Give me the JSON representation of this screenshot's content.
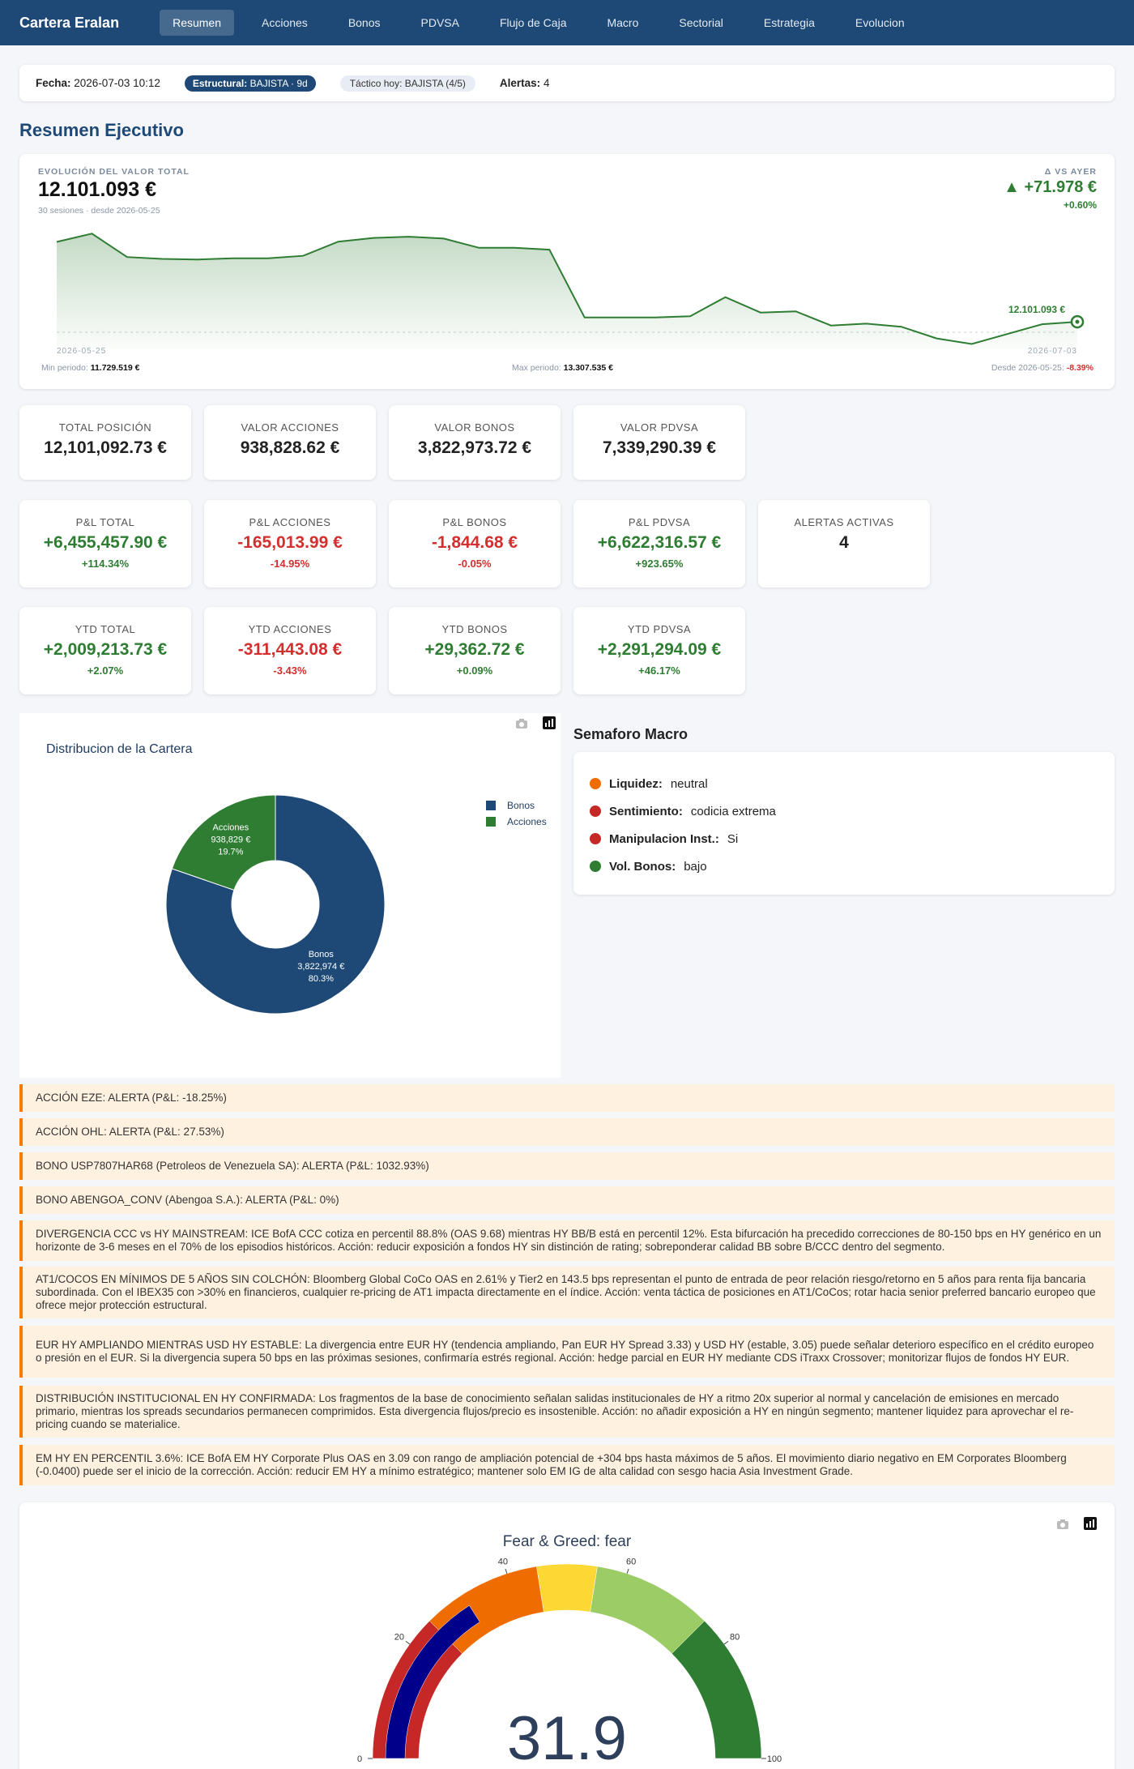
{
  "nav": {
    "brand": "Cartera Eralan",
    "tabs": [
      "Resumen",
      "Acciones",
      "Bonos",
      "PDVSA",
      "Flujo de Caja",
      "Macro",
      "Sectorial",
      "Estrategia",
      "Evolucion"
    ]
  },
  "infobar": {
    "fecha_label": "Fecha:",
    "fecha_value": "2026-07-03 10:12",
    "estructural_label": "Estructural:",
    "estructural_value": "BAJISTA · 9d",
    "tactico": "Táctico hoy: BAJISTA (4/5)",
    "alertas_label": "Alertas:",
    "alertas_value": "4"
  },
  "section_title": "Resumen Ejecutivo",
  "evolution": {
    "label": "EVOLUCIÓN DEL VALOR TOTAL",
    "value": "12.101.093 €",
    "sub": "30 sesiones · desde 2026-05-25",
    "delta_label": "Δ VS AYER",
    "delta_value": "▲ +71.978 €",
    "delta_pct": "+0.60%",
    "end_label": "12.101.093 €",
    "start_date": "2026-05-25",
    "end_date": "2026-07-03",
    "min_label": "Min periodo:",
    "min_value": "11.729.519 €",
    "max_label": "Max periodo:",
    "max_value": "13.307.535 €",
    "since_label": "Desde 2026-05-25:",
    "since_value": "-8.39%",
    "series": [
      13108000,
      13175000,
      12985000,
      12970000,
      12965000,
      12975000,
      12975000,
      12995000,
      13110000,
      13140000,
      13150000,
      13135000,
      13060000,
      13060000,
      13045000,
      12495000,
      12495000,
      12495000,
      12505000,
      12660000,
      12535000,
      12545000,
      12430000,
      12445000,
      12420000,
      12325000,
      12280000,
      12360000,
      12440000,
      12460000
    ]
  },
  "stats_row1": [
    {
      "label": "TOTAL POSICIÓN",
      "value": "12,101,092.73 €"
    },
    {
      "label": "VALOR ACCIONES",
      "value": "938,828.62 €"
    },
    {
      "label": "VALOR BONOS",
      "value": "3,822,973.72 €"
    },
    {
      "label": "VALOR PDVSA",
      "value": "7,339,290.39 €"
    }
  ],
  "stats_row2": [
    {
      "label": "P&L TOTAL",
      "value": "+6,455,457.90 €",
      "pct": "+114.34%"
    },
    {
      "label": "P&L ACCIONES",
      "value": "-165,013.99 €",
      "pct": "-14.95%"
    },
    {
      "label": "P&L BONOS",
      "value": "-1,844.68 €",
      "pct": "-0.05%"
    },
    {
      "label": "P&L PDVSA",
      "value": "+6,622,316.57 €",
      "pct": "+923.65%"
    },
    {
      "label": "ALERTAS ACTIVAS",
      "value": "4"
    }
  ],
  "stats_row3": [
    {
      "label": "YTD TOTAL",
      "value": "+2,009,213.73 €",
      "pct": "+2.07%"
    },
    {
      "label": "YTD ACCIONES",
      "value": "-311,443.08 €",
      "pct": "-3.43%"
    },
    {
      "label": "YTD BONOS",
      "value": "+29,362.72 €",
      "pct": "+0.09%"
    },
    {
      "label": "YTD PDVSA",
      "value": "+2,291,294.09 €",
      "pct": "+46.17%"
    }
  ],
  "chart_data": [
    {
      "type": "pie",
      "title": "Distribucion de la Cartera",
      "categories": [
        "Bonos",
        "Acciones"
      ],
      "values": [
        3822974,
        938829
      ],
      "value_labels": [
        "3,822,974 €",
        "938,829 €"
      ],
      "percent_labels": [
        "80.3%",
        "19.7%"
      ],
      "colors": [
        "#1e4976",
        "#2e7d32"
      ],
      "legend": "top-right"
    },
    {
      "type": "gauge",
      "title": "Fear & Greed: fear",
      "value": 31.9,
      "range": [
        0,
        100
      ],
      "ticks": [
        0,
        20,
        40,
        60,
        80,
        100
      ],
      "bands": [
        {
          "from": 0,
          "to": 25,
          "color": "#c62828"
        },
        {
          "from": 25,
          "to": 45,
          "color": "#ef6c00"
        },
        {
          "from": 45,
          "to": 55,
          "color": "#fdd835"
        },
        {
          "from": 55,
          "to": 75,
          "color": "#9ccc65"
        },
        {
          "from": 75,
          "to": 100,
          "color": "#2e7d32"
        }
      ],
      "bar_color": "#00008b"
    }
  ],
  "semaforo": {
    "title": "Semaforo Macro",
    "items": [
      {
        "label": "Liquidez:",
        "value": "neutral",
        "color": "#ef6c00"
      },
      {
        "label": "Sentimiento:",
        "value": "codicia extrema",
        "color": "#c62828"
      },
      {
        "label": "Manipulacion Inst.:",
        "value": "Si",
        "color": "#c62828"
      },
      {
        "label": "Vol. Bonos:",
        "value": "bajo",
        "color": "#2e7d32"
      }
    ]
  },
  "alerts": [
    "ACCIÓN EZE: ALERTA (P&L: -18.25%)",
    "ACCIÓN OHL: ALERTA (P&L: 27.53%)",
    "BONO USP7807HAR68 (Petroleos de Venezuela SA): ALERTA (P&L: 1032.93%)",
    "BONO ABENGOA_CONV (Abengoa S.A.): ALERTA (P&L: 0%)",
    "DIVERGENCIA CCC vs HY MAINSTREAM: ICE BofA CCC cotiza en percentil 88.8% (OAS 9.68) mientras HY BB/B está en percentil 12%. Esta bifurcación ha precedido correcciones de 80-150 bps en HY genérico en un horizonte de 3-6 meses en el 70% de los episodios históricos. Acción: reducir exposición a fondos HY sin distinción de rating; sobreponderar calidad BB sobre B/CCC dentro del segmento.",
    "AT1/COCOS EN MÍNIMOS DE 5 AÑOS SIN COLCHÓN: Bloomberg Global CoCo OAS en 2.61% y Tier2 en 143.5 bps representan el punto de entrada de peor relación riesgo/retorno en 5 años para renta fija bancaria subordinada. Con el IBEX35 con >30% en financieros, cualquier re-pricing de AT1 impacta directamente en el índice. Acción: venta táctica de posiciones en AT1/CoCos; rotar hacia senior preferred bancario europeo que ofrece mejor protección estructural.",
    "EUR HY AMPLIANDO MIENTRAS USD HY ESTABLE: La divergencia entre EUR HY (tendencia ampliando, Pan EUR HY Spread 3.33) y USD HY (estable, 3.05) puede señalar deterioro específico en el crédito europeo o presión en el EUR. Si la divergencia supera 50 bps en las próximas sesiones, confirmaría estrés regional. Acción: hedge parcial en EUR HY mediante CDS iTraxx Crossover; monitorizar flujos de fondos HY EUR.",
    "DISTRIBUCIÓN INSTITUCIONAL EN HY CONFIRMADA: Los fragmentos de la base de conocimiento señalan salidas institucionales de HY a ritmo 20x superior al normal y cancelación de emisiones en mercado primario, mientras los spreads secundarios permanecen comprimidos. Esta divergencia flujos/precio es insostenible. Acción: no añadir exposición a HY en ningún segmento; mantener liquidez para aprovechar el re-pricing cuando se materialice.",
    "EM HY EN PERCENTIL 3.6%: ICE BofA EM HY Corporate Plus OAS en 3.09 con rango de ampliación potencial de +304 bps hasta máximos de 5 años. El movimiento diario negativo en EM Corporates Bloomberg (-0.0400) puede ser el inicio de la corrección. Acción: reducir EM HY a mínimo estratégico; mantener solo EM IG de alta calidad con sesgo hacia Asia Investment Grade."
  ]
}
